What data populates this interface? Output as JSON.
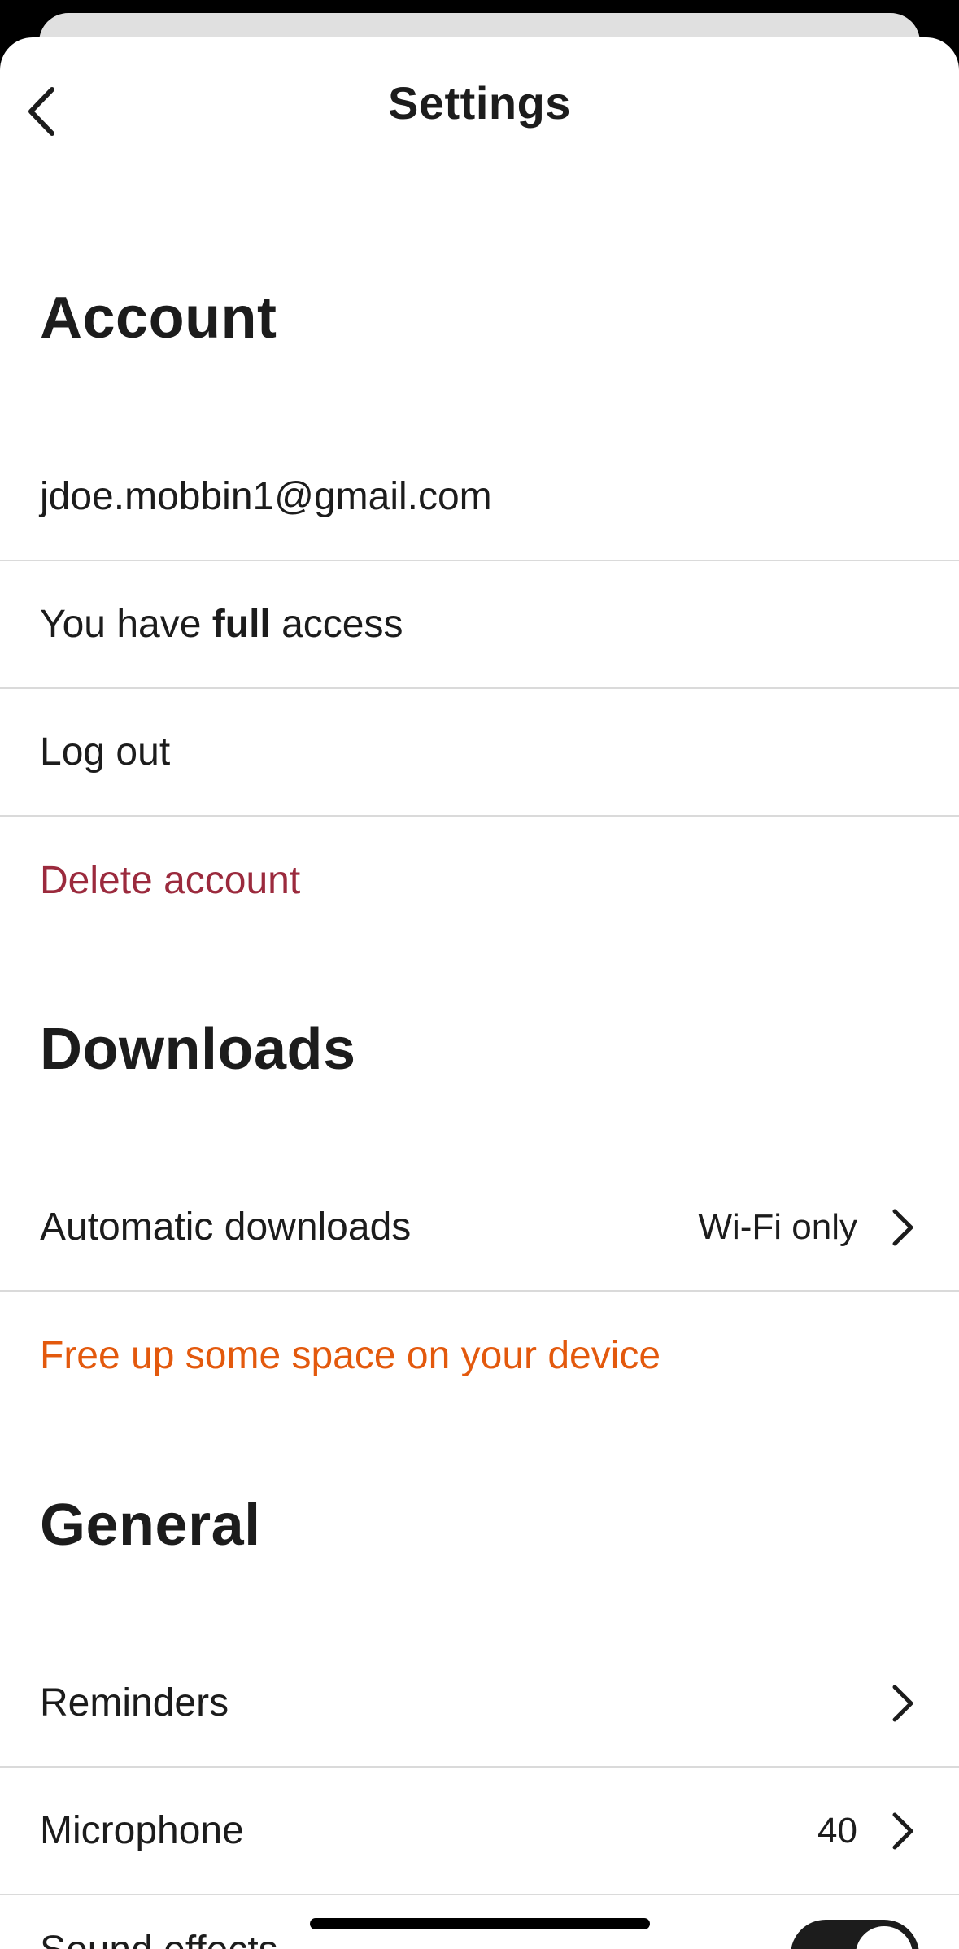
{
  "header": {
    "title": "Settings"
  },
  "account": {
    "title": "Account",
    "email": "jdoe.mobbin1@gmail.com",
    "access": {
      "prefix": "You have ",
      "emphasis": "full",
      "suffix": " access"
    },
    "logout_label": "Log out",
    "delete_label": "Delete account"
  },
  "downloads": {
    "title": "Downloads",
    "automatic_label": "Automatic downloads",
    "automatic_value": "Wi-Fi only",
    "free_space_label": "Free up some space on your device"
  },
  "general": {
    "title": "General",
    "reminders_label": "Reminders",
    "microphone_label": "Microphone",
    "microphone_value": "40",
    "sound_effects_label": "Sound effects",
    "sound_effects_on": true
  },
  "colors": {
    "danger": "#9b2a3d",
    "accent": "#e3590d",
    "toggle_on": "#1c1c1c"
  },
  "icons": {
    "back": "chevron-left-icon",
    "row_chevron": "chevron-right-icon"
  }
}
